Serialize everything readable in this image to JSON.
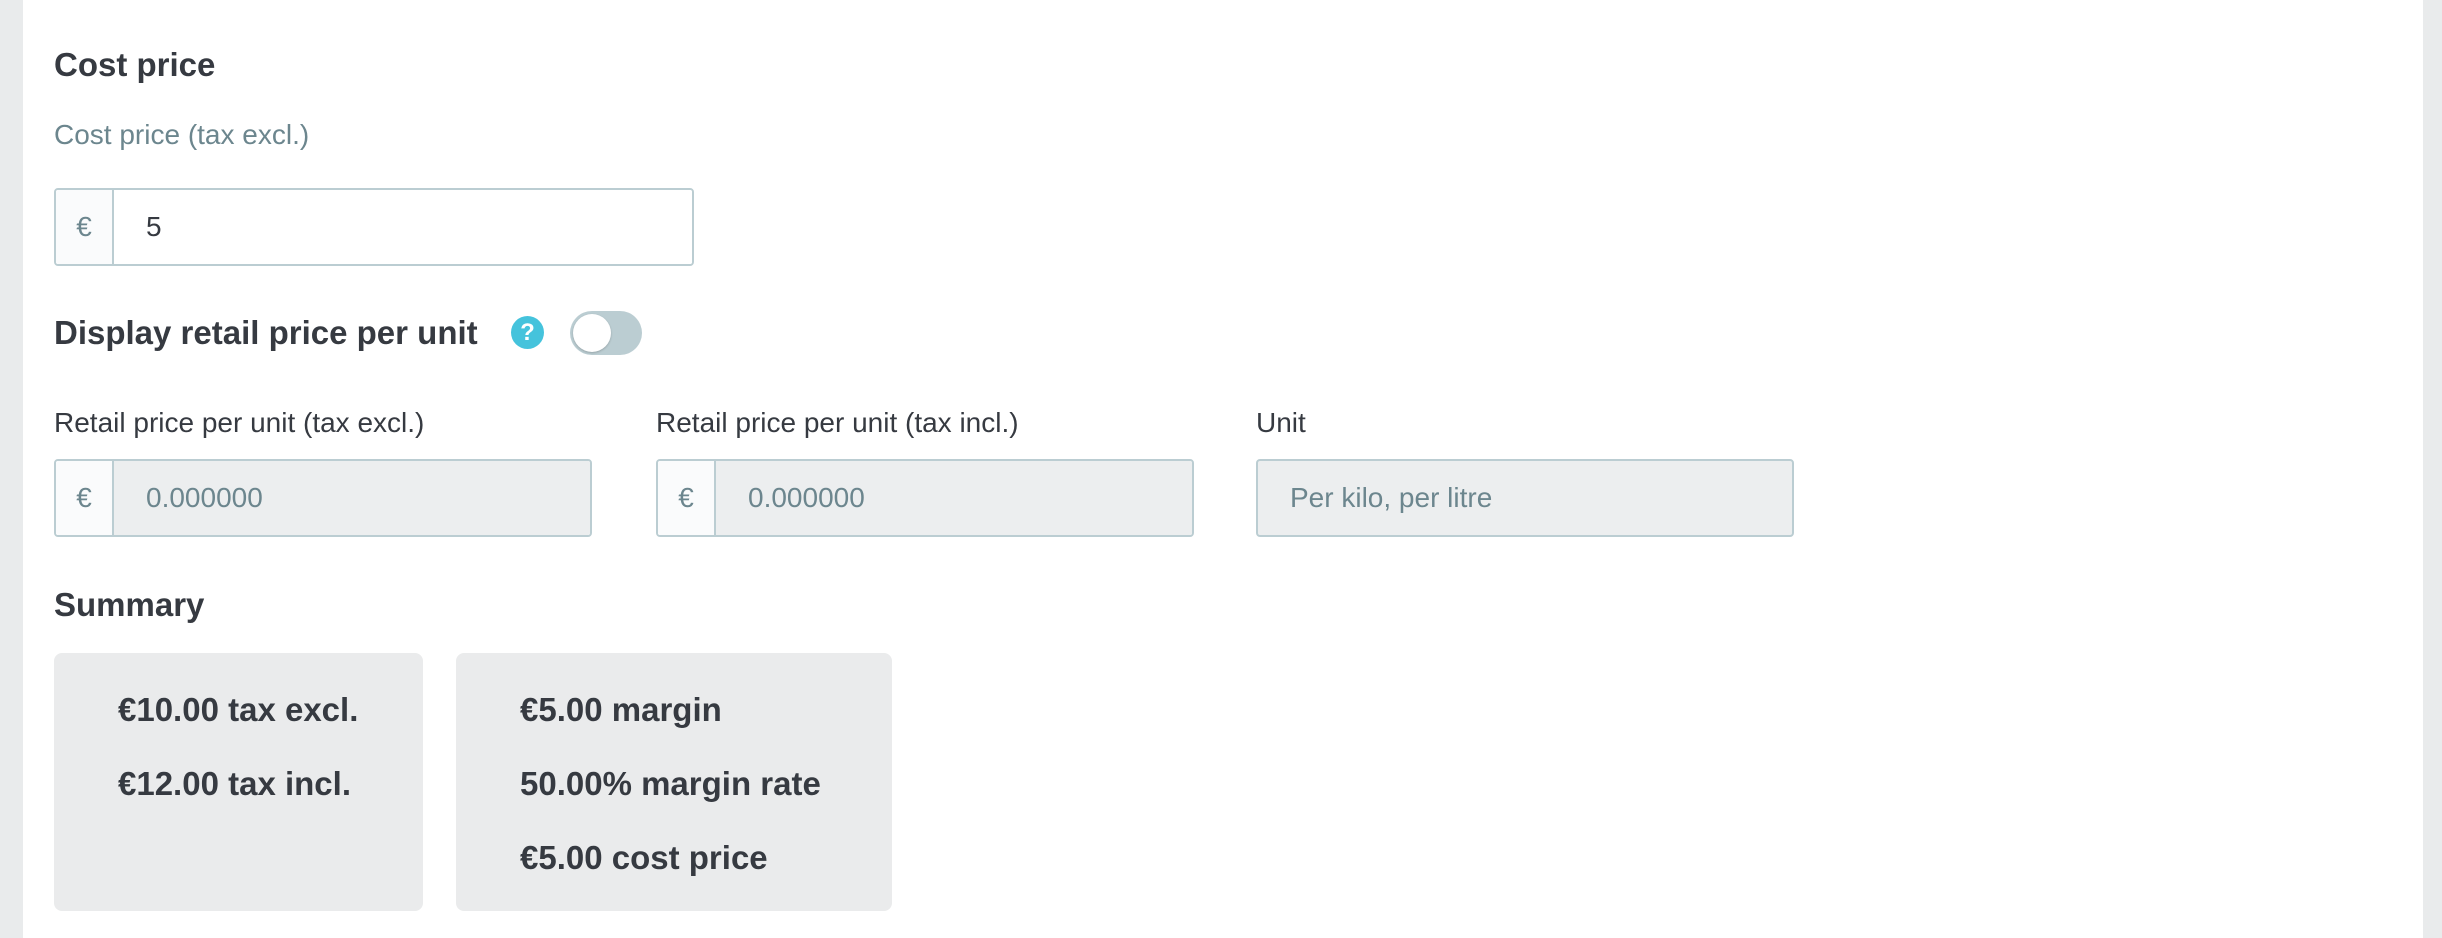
{
  "cost_price": {
    "title": "Cost price",
    "field_label": "Cost price (tax excl.)",
    "currency_symbol": "€",
    "value": "5"
  },
  "unit_price": {
    "title": "Display retail price per unit",
    "help_glyph": "?",
    "toggle_enabled": false,
    "fields": [
      {
        "label": "Retail price per unit (tax excl.)",
        "currency_symbol": "€",
        "placeholder": "0.000000"
      },
      {
        "label": "Retail price per unit (tax incl.)",
        "currency_symbol": "€",
        "placeholder": "0.000000"
      }
    ],
    "unit_field": {
      "label": "Unit",
      "placeholder": "Per kilo, per litre"
    }
  },
  "summary": {
    "title": "Summary",
    "price_card": [
      "€10.00 tax excl.",
      "€12.00 tax incl."
    ],
    "margin_card": [
      "€5.00 margin",
      "50.00% margin rate",
      "€5.00 cost price"
    ]
  },
  "colors": {
    "accent": "#25b9d7",
    "border": "#bbcdd2",
    "muted_text": "#6c868e",
    "text": "#363a41",
    "disabled_bg": "#eceeef"
  }
}
